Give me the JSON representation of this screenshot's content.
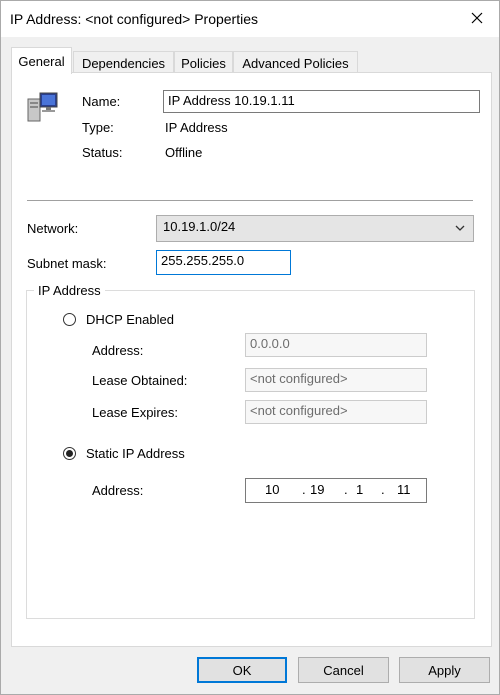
{
  "window": {
    "title": "IP Address: <not configured> Properties"
  },
  "tabs": [
    {
      "label": "General"
    },
    {
      "label": "Dependencies"
    },
    {
      "label": "Policies"
    },
    {
      "label": "Advanced Policies"
    }
  ],
  "general": {
    "resource_icon": "network-computer-icon",
    "name_label": "Name:",
    "name_value": "IP Address 10.19.1.11",
    "type_label": "Type:",
    "type_value": "IP Address",
    "status_label": "Status:",
    "status_value": "Offline"
  },
  "network": {
    "label": "Network:",
    "selected": "10.19.1.0/24",
    "subnet_label": "Subnet mask:",
    "subnet_value": "255.255.255.0"
  },
  "ip_group": {
    "title": "IP Address",
    "dhcp": {
      "label": "DHCP Enabled",
      "checked": false,
      "address_label": "Address:",
      "address_value": "0.0.0.0",
      "lease_obtained_label": "Lease Obtained:",
      "lease_obtained_value": "<not configured>",
      "lease_expires_label": "Lease Expires:",
      "lease_expires_value": "<not configured>"
    },
    "static": {
      "label": "Static IP Address",
      "checked": true,
      "address_label": "Address:",
      "octets": [
        "10",
        "19",
        "1",
        "11"
      ]
    }
  },
  "buttons": {
    "ok": "OK",
    "cancel": "Cancel",
    "apply": "Apply"
  }
}
